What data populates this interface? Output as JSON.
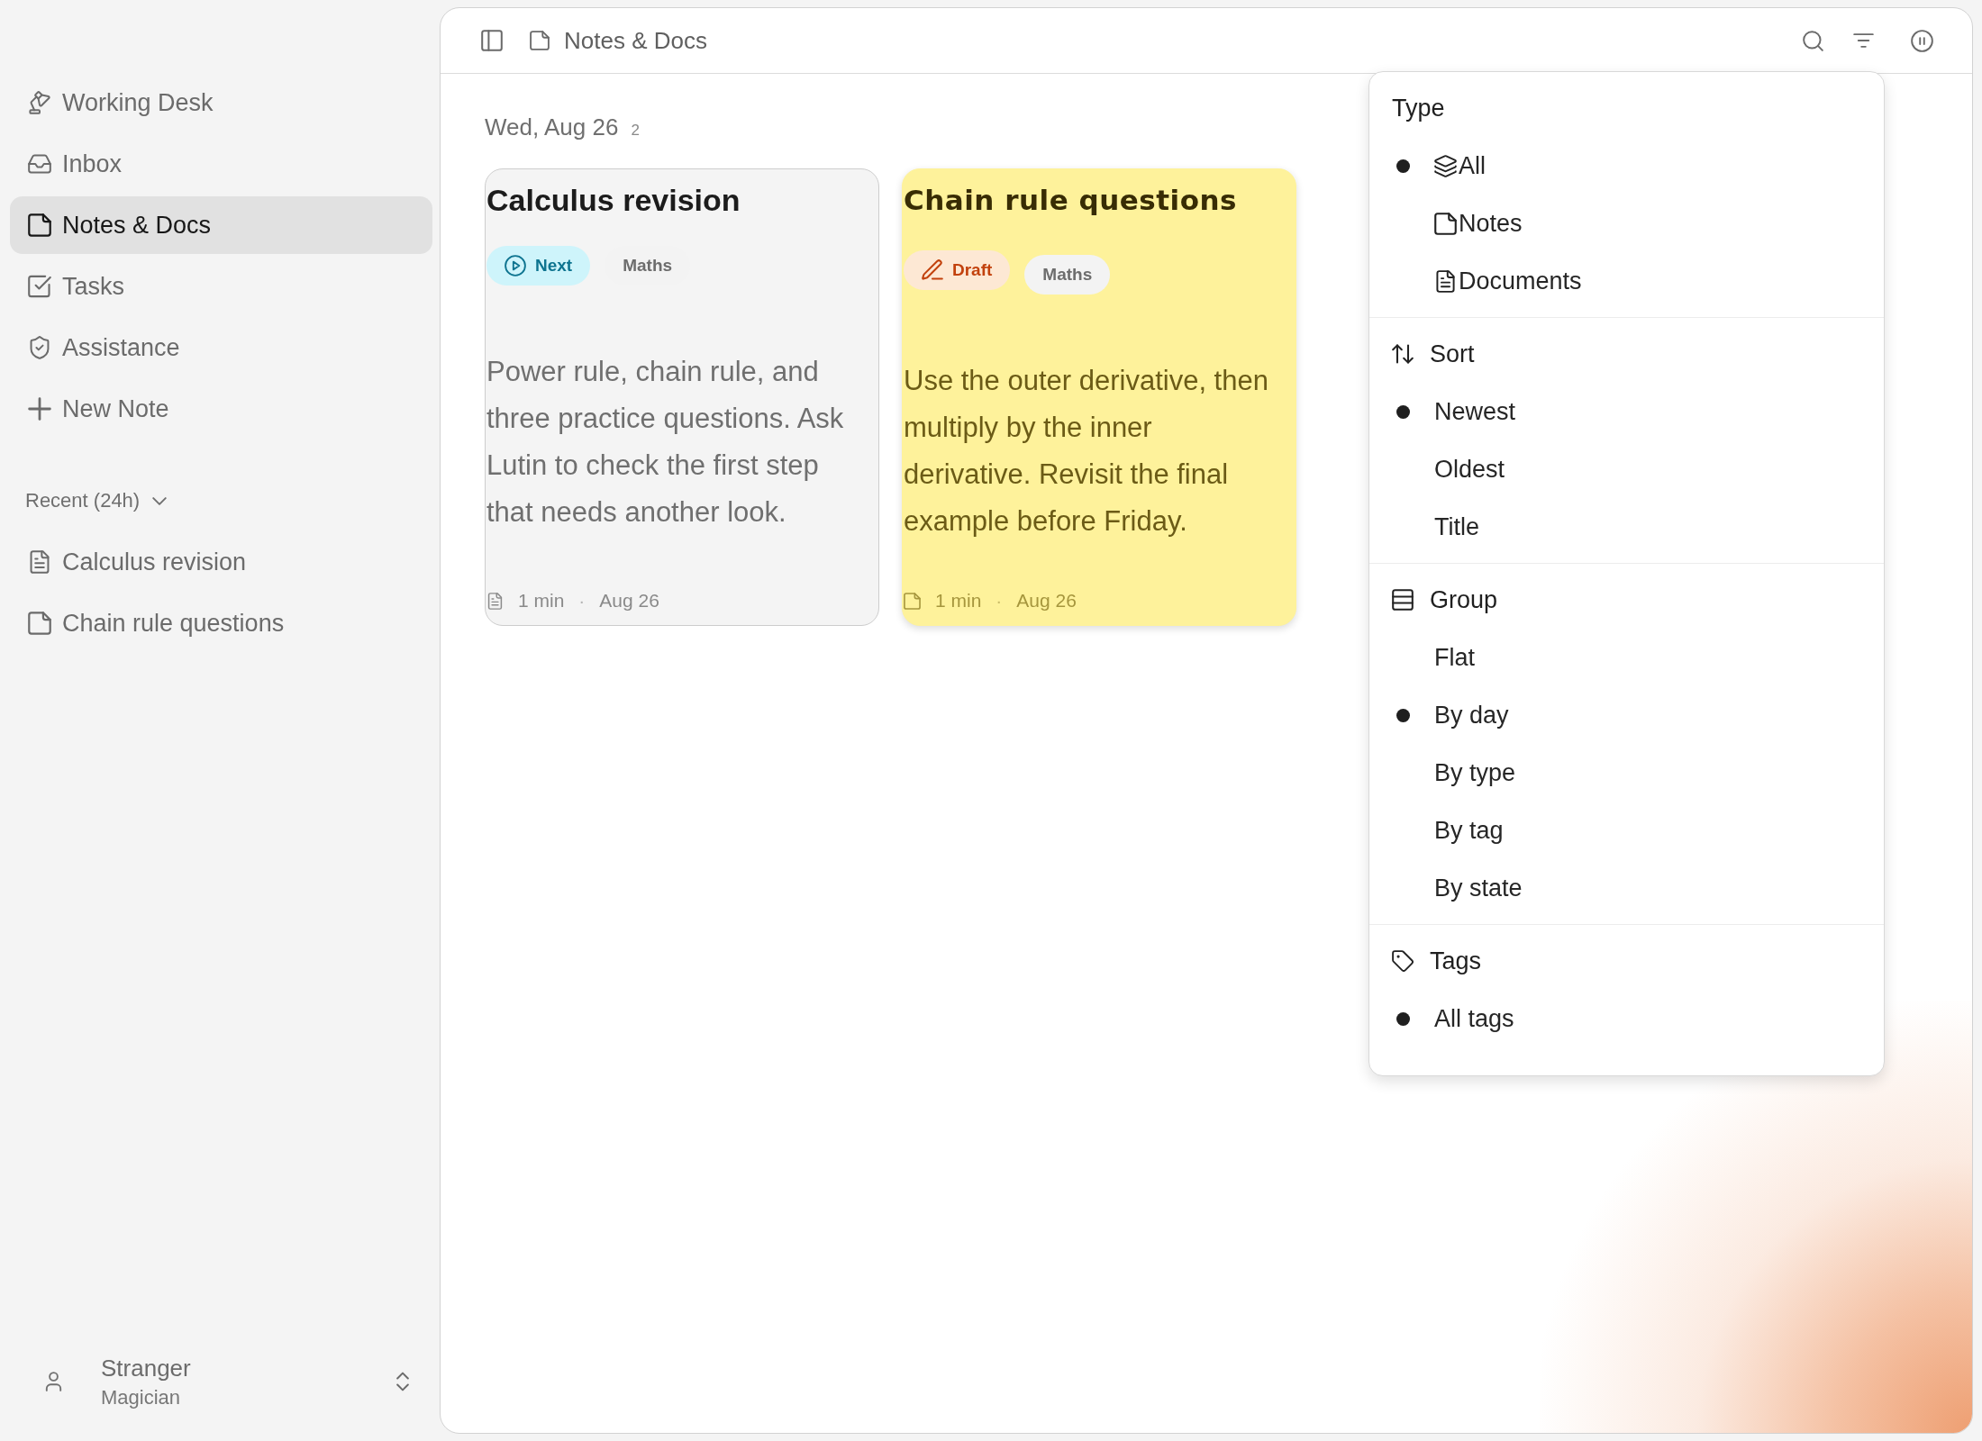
{
  "sidebar": {
    "items": [
      {
        "label": "Working Desk",
        "selected": false
      },
      {
        "label": "Inbox",
        "selected": false
      },
      {
        "label": "Notes & Docs",
        "selected": true
      },
      {
        "label": "Tasks",
        "selected": false
      },
      {
        "label": "Assistance",
        "selected": false
      },
      {
        "label": "New Note",
        "selected": false
      }
    ],
    "recent": {
      "label": "Recent (24h)",
      "expanded": true,
      "items": [
        {
          "label": "Calculus revision",
          "kind": "document"
        },
        {
          "label": "Chain rule questions",
          "kind": "note"
        }
      ]
    },
    "user": {
      "name": "Stranger",
      "role": "Magician"
    }
  },
  "toolbar": {
    "title": "Notes & Docs"
  },
  "groups": [
    {
      "heading": "Wed, Aug 26",
      "count": "2",
      "cards": [
        {
          "kind": "document",
          "title": "Calculus revision",
          "tags": [
            {
              "label": "Next",
              "kind": "next"
            },
            {
              "label": "Maths",
              "kind": "topic"
            }
          ],
          "body": "Power rule, chain rule, and three practice questions. Ask Lutin to check the first step that needs another look.",
          "read_time": "1 min",
          "separator": "·",
          "date": "Aug 26"
        },
        {
          "kind": "note",
          "title": "Chain rule questions",
          "tags": [
            {
              "label": "Draft",
              "kind": "draft"
            },
            {
              "label": "Maths",
              "kind": "topic"
            }
          ],
          "body": "Use the outer derivative, then multiply by the inner derivative. Revisit the final example before Friday.",
          "read_time": "1 min",
          "separator": "·",
          "date": "Aug 26"
        }
      ]
    }
  ],
  "filter_menu": {
    "sections": [
      {
        "title": "Type",
        "kind": "type",
        "items": [
          {
            "label": "All",
            "kind": "all",
            "selected": true
          },
          {
            "label": "Notes",
            "kind": "note",
            "selected": false
          },
          {
            "label": "Documents",
            "kind": "document",
            "selected": false
          }
        ]
      },
      {
        "title": "Sort",
        "kind": "sort",
        "items": [
          {
            "label": "Newest",
            "selected": true
          },
          {
            "label": "Oldest",
            "selected": false
          },
          {
            "label": "Title",
            "selected": false
          }
        ]
      },
      {
        "title": "Group",
        "kind": "group",
        "items": [
          {
            "label": "Flat",
            "selected": false
          },
          {
            "label": "By day",
            "selected": true
          },
          {
            "label": "By type",
            "selected": false
          },
          {
            "label": "By tag",
            "selected": false
          },
          {
            "label": "By state",
            "selected": false
          }
        ]
      },
      {
        "title": "Tags",
        "kind": "tags",
        "items": [
          {
            "label": "All tags",
            "selected": true
          }
        ]
      }
    ]
  }
}
